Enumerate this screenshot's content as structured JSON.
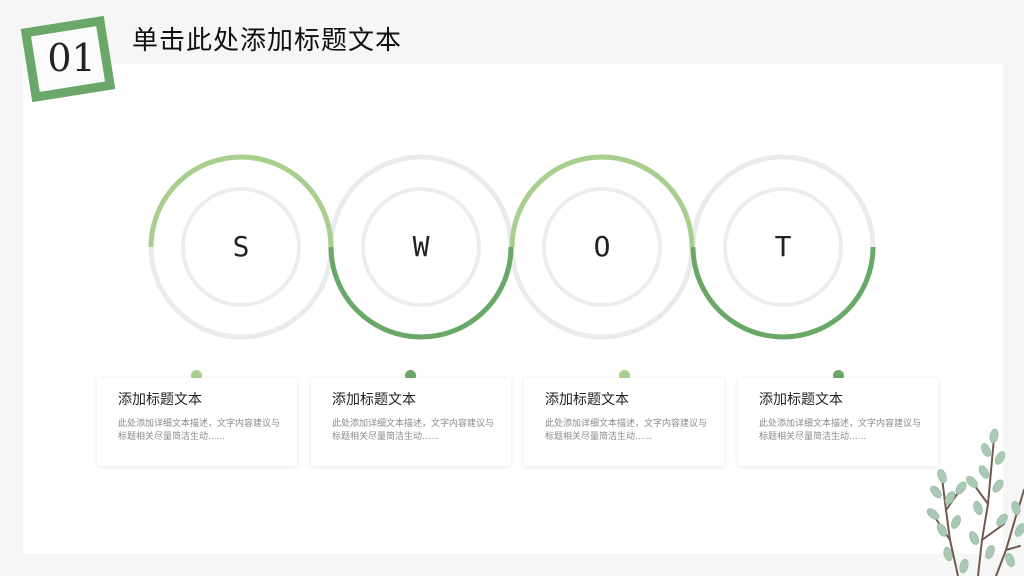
{
  "header": {
    "number": "01",
    "title": "单击此处添加标题文本"
  },
  "swot": {
    "letters": [
      "S",
      "W",
      "O",
      "T"
    ]
  },
  "cards": [
    {
      "title": "添加标题文本",
      "description": "此处添加详细文本描述，文字内容建议与标题相关尽量简洁生动......"
    },
    {
      "title": "添加标题文本",
      "description": "此处添加详细文本描述，文字内容建议与标题相关尽量简洁生动......"
    },
    {
      "title": "添加标题文本",
      "description": "此处添加详细文本描述，文字内容建议与标题相关尽量简洁生动......"
    },
    {
      "title": "添加标题文本",
      "description": "此处添加详细文本描述，文字内容建议与标题相关尽量简洁生动......"
    }
  ],
  "colors": {
    "accent_light": "#a9cf8e",
    "accent_dark": "#69a867",
    "ring_gray": "#ebebeb",
    "badge_green": "#6aa86a"
  }
}
